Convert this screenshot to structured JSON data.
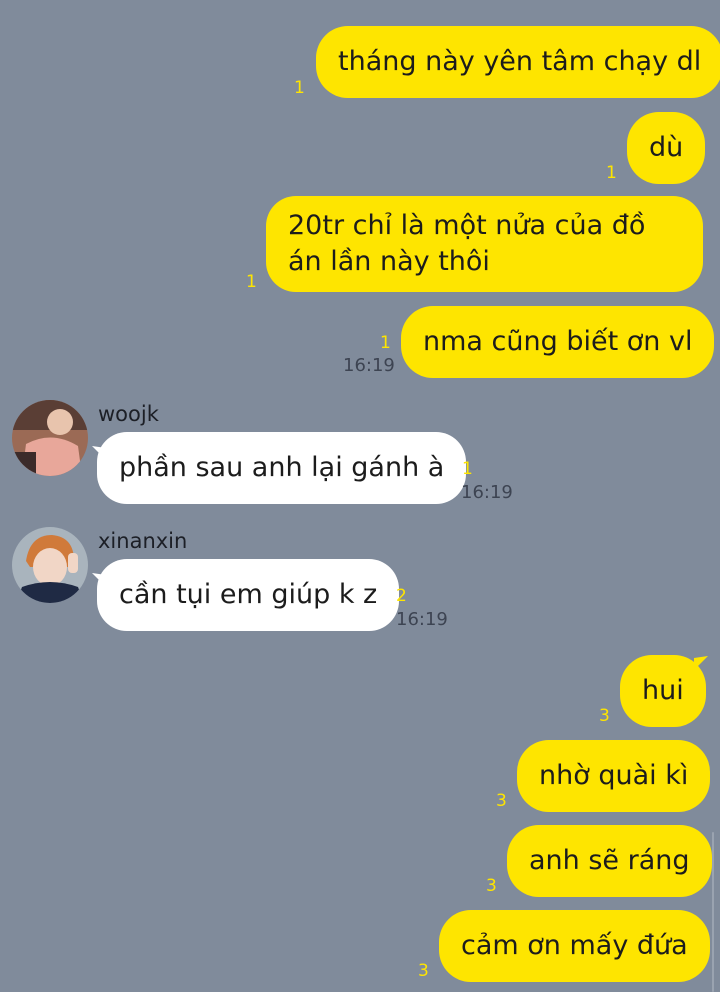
{
  "messages": [
    {
      "id": "m1",
      "text": "tháng này yên tâm chạy dl",
      "unread": "1"
    },
    {
      "id": "m2",
      "text": "dù",
      "unread": "1"
    },
    {
      "id": "m3",
      "text": "20tr chỉ là một nửa của đồ án lần này thôi",
      "unread": "1"
    },
    {
      "id": "m4",
      "text": "nma cũng biết ơn vl",
      "unread": "1",
      "time": "16:19"
    },
    {
      "id": "m5",
      "sender": "woojk",
      "text": "phần sau anh lại gánh à",
      "unread": "1",
      "time": "16:19"
    },
    {
      "id": "m6",
      "sender": "xinanxin",
      "text": "cần tụi em giúp k z",
      "unread": "2",
      "time": "16:19"
    },
    {
      "id": "m7",
      "text": "hui",
      "unread": "3"
    },
    {
      "id": "m8",
      "text": "nhờ quài kì",
      "unread": "3"
    },
    {
      "id": "m9",
      "text": "anh sẽ ráng",
      "unread": "3"
    },
    {
      "id": "m10",
      "text": "cảm ơn mấy đứa",
      "unread": "3"
    }
  ],
  "colors": {
    "background": "#808b9b",
    "my_bubble": "#fee500",
    "their_bubble": "#ffffff",
    "unread_count": "#fee500"
  },
  "icons": {
    "avatar_woojk": "avatar-woojk",
    "avatar_xinanxin": "avatar-xinanxin"
  }
}
